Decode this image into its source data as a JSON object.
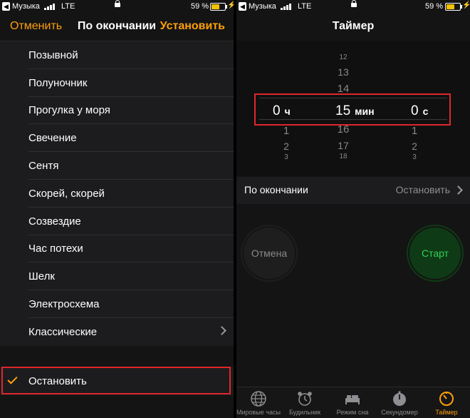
{
  "left": {
    "status": {
      "carrier": "Музыка",
      "network": "LTE",
      "battery": "59 %"
    },
    "nav": {
      "cancel": "Отменить",
      "title": "По окончании",
      "set": "Установить"
    },
    "sounds": [
      {
        "label": "Позывной"
      },
      {
        "label": "Полуночник"
      },
      {
        "label": "Прогулка у моря"
      },
      {
        "label": "Свечение"
      },
      {
        "label": "Сентя"
      },
      {
        "label": "Скорей, скорей"
      },
      {
        "label": "Созвездие"
      },
      {
        "label": "Час потехи"
      },
      {
        "label": "Шелк"
      },
      {
        "label": "Электросхема"
      },
      {
        "label": "Классические"
      }
    ],
    "selected": "Остановить"
  },
  "right": {
    "status": {
      "carrier": "Музыка",
      "network": "LTE",
      "battery": "59 %"
    },
    "nav": {
      "title": "Таймер"
    },
    "picker": {
      "hours": {
        "value": "0",
        "unit": "ч",
        "below": [
          "1",
          "2",
          "3"
        ]
      },
      "minutes": {
        "value": "15",
        "unit": "мин",
        "above": [
          "12",
          "13",
          "14"
        ],
        "below": [
          "16",
          "17",
          "18"
        ]
      },
      "seconds": {
        "value": "0",
        "unit": "с",
        "below": [
          "1",
          "2",
          "3"
        ]
      }
    },
    "when_done": {
      "label": "По окончании",
      "value": "Остановить"
    },
    "buttons": {
      "cancel": "Отмена",
      "start": "Старт"
    },
    "tabs": [
      {
        "label": "Мировые часы",
        "icon": "globe-icon"
      },
      {
        "label": "Будильник",
        "icon": "alarm-clock-icon"
      },
      {
        "label": "Режим сна",
        "icon": "bed-icon"
      },
      {
        "label": "Секундомер",
        "icon": "stopwatch-icon"
      },
      {
        "label": "Таймер",
        "icon": "timer-icon",
        "active": true
      }
    ]
  },
  "colors": {
    "accent": "#ff9f0a",
    "start_green": "#2fd158",
    "highlight_box": "#e0262a"
  }
}
